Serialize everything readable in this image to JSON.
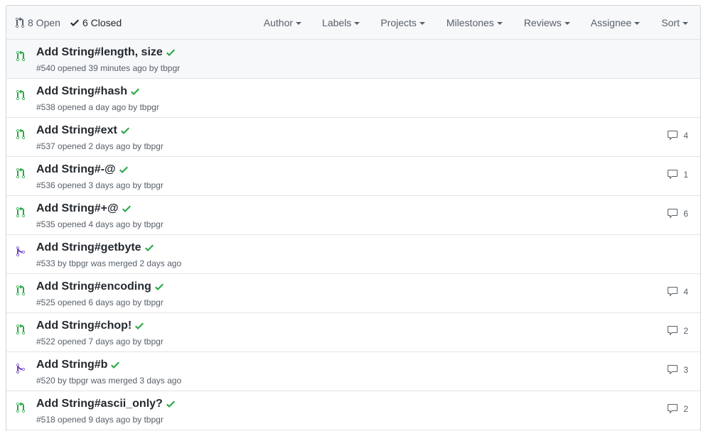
{
  "header": {
    "open_label": "8 Open",
    "closed_label": "6 Closed",
    "filters": [
      "Author",
      "Labels",
      "Projects",
      "Milestones",
      "Reviews",
      "Assignee",
      "Sort"
    ]
  },
  "colors": {
    "open": "#28a745",
    "merged": "#6f42c1",
    "check": "#28a745",
    "muted": "#586069"
  },
  "pulls": [
    {
      "title": "Add String#length, size",
      "meta": "#540 opened 39 minutes ago by tbpgr",
      "state": "open",
      "comments": ""
    },
    {
      "title": "Add String#hash",
      "meta": "#538 opened a day ago by tbpgr",
      "state": "open",
      "comments": ""
    },
    {
      "title": "Add String#ext",
      "meta": "#537 opened 2 days ago by tbpgr",
      "state": "open",
      "comments": "4"
    },
    {
      "title": "Add String#-@",
      "meta": "#536 opened 3 days ago by tbpgr",
      "state": "open",
      "comments": "1"
    },
    {
      "title": "Add String#+@",
      "meta": "#535 opened 4 days ago by tbpgr",
      "state": "open",
      "comments": "6"
    },
    {
      "title": "Add String#getbyte",
      "meta": "#533 by tbpgr was merged 2 days ago",
      "state": "merged",
      "comments": ""
    },
    {
      "title": "Add String#encoding",
      "meta": "#525 opened 6 days ago by tbpgr",
      "state": "open",
      "comments": "4"
    },
    {
      "title": "Add String#chop!",
      "meta": "#522 opened 7 days ago by tbpgr",
      "state": "open",
      "comments": "2"
    },
    {
      "title": "Add String#b",
      "meta": "#520 by tbpgr was merged 3 days ago",
      "state": "merged",
      "comments": "3"
    },
    {
      "title": "Add String#ascii_only?",
      "meta": "#518 opened 9 days ago by tbpgr",
      "state": "open",
      "comments": "2"
    }
  ]
}
